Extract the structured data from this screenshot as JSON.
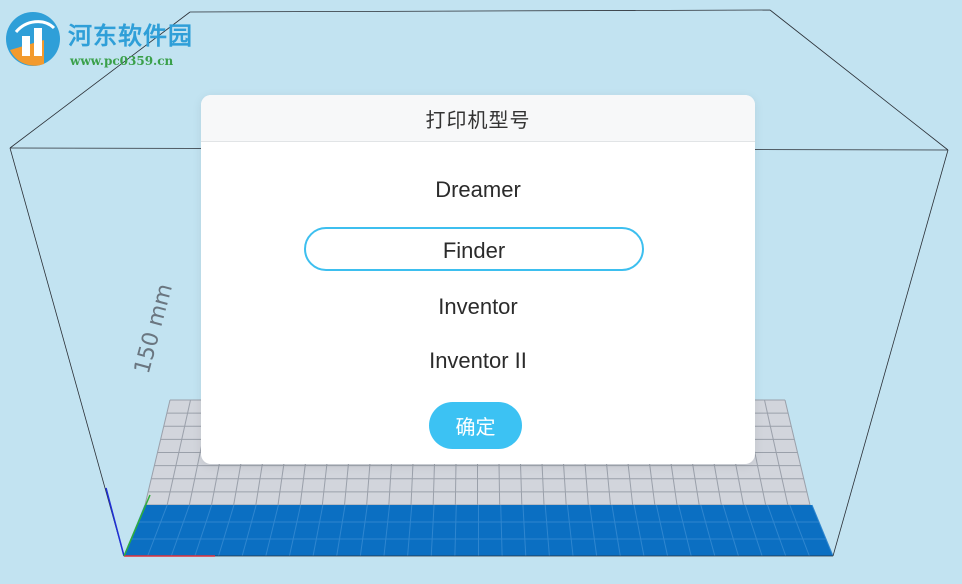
{
  "watermark": {
    "title": "河东软件园",
    "url": "www.pc0359.cn"
  },
  "viewport": {
    "axis_label": "150 mm"
  },
  "dialog": {
    "title": "打印机型号",
    "options": [
      {
        "label": "Dreamer",
        "selected": false
      },
      {
        "label": "Finder",
        "selected": true
      },
      {
        "label": "Inventor",
        "selected": false
      },
      {
        "label": "Inventor II",
        "selected": false
      }
    ],
    "confirm_label": "确定"
  },
  "colors": {
    "background": "#c2e3f1",
    "accent": "#3cc2f3",
    "build_plate": "#0b6fc2",
    "grid": "#c3c7cf"
  }
}
